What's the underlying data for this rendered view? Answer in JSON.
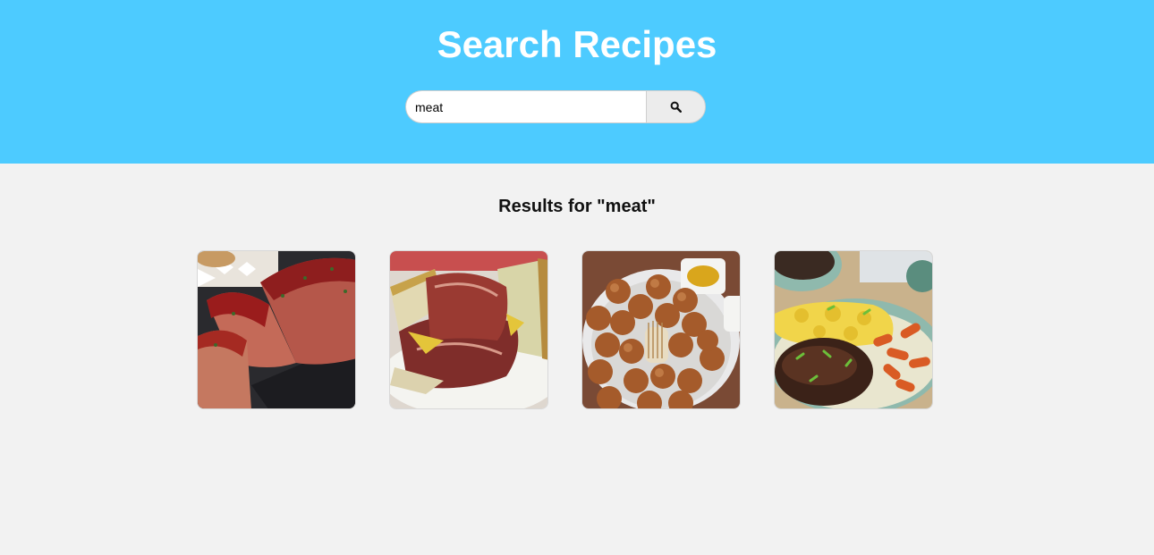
{
  "header": {
    "title": "Search Recipes",
    "background": "#4dcbff"
  },
  "search": {
    "value": "meat",
    "placeholder": "",
    "button_icon": "search-icon"
  },
  "results": {
    "heading": "Results for \"meat\"",
    "items": [
      {
        "name": "meatloaf-recipe-card",
        "image": "sliced glazed meatloaf"
      },
      {
        "name": "pastrami-sandwich-recipe-card",
        "image": "pastrami sandwich on plate"
      },
      {
        "name": "meatballs-recipe-card",
        "image": "bowl of fried meatballs with mustard"
      },
      {
        "name": "salisbury-steak-recipe-card",
        "image": "steak with mashed potatoes and carrots"
      }
    ]
  }
}
